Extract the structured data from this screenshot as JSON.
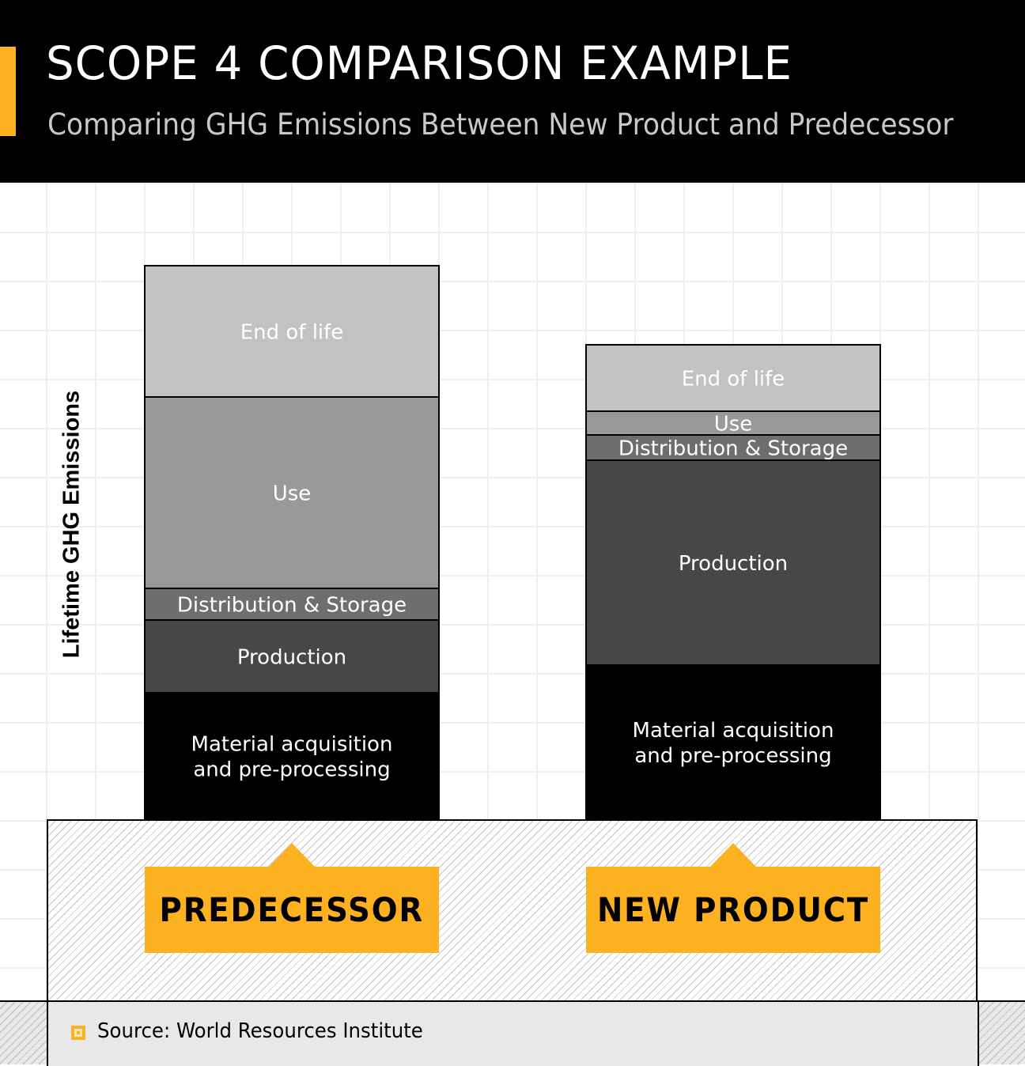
{
  "header": {
    "title": "SCOPE 4 COMPARISON EXAMPLE",
    "subtitle": "Comparing GHG Emissions Between New Product and Predecessor"
  },
  "colors": {
    "accent": "#fbb120",
    "header_bg": "#000000",
    "material": "#000000",
    "production": "#474747",
    "distribution": "#6e6e6e",
    "use": "#999999",
    "end_of_life": "#c2c2c2"
  },
  "chart_data": {
    "type": "bar",
    "stacked": true,
    "title": "SCOPE 4 COMPARISON EXAMPLE",
    "subtitle": "Comparing GHG Emissions Between New Product and Predecessor",
    "xlabel": "",
    "ylabel": "Lifetime GHG Emissions",
    "units": "relative (no numeric axis shown)",
    "categories": [
      "PREDECESSOR",
      "NEW PRODUCT"
    ],
    "ylim": [
      0,
      800
    ],
    "grid": true,
    "series": [
      {
        "name": "Material acquisition and pre-processing",
        "label_lines": [
          "Material acquisition",
          "and pre-processing"
        ],
        "color_key": "material",
        "values": [
          160,
          195
        ]
      },
      {
        "name": "Production",
        "label_lines": [
          "Production"
        ],
        "color_key": "production",
        "values": [
          92,
          259
        ]
      },
      {
        "name": "Distribution & Storage",
        "label_lines": [
          "Distribution & Storage"
        ],
        "color_key": "distribution",
        "values": [
          40,
          32
        ]
      },
      {
        "name": "Use",
        "label_lines": [
          "Use"
        ],
        "color_key": "use",
        "values": [
          242,
          30
        ]
      },
      {
        "name": "End of life",
        "label_lines": [
          "End of life"
        ],
        "color_key": "end_of_life",
        "values": [
          166,
          84
        ]
      }
    ]
  },
  "labels": {
    "predecessor": "PREDECESSOR",
    "new_product": "NEW PRODUCT"
  },
  "footer": {
    "source": "Source: World Resources Institute"
  }
}
